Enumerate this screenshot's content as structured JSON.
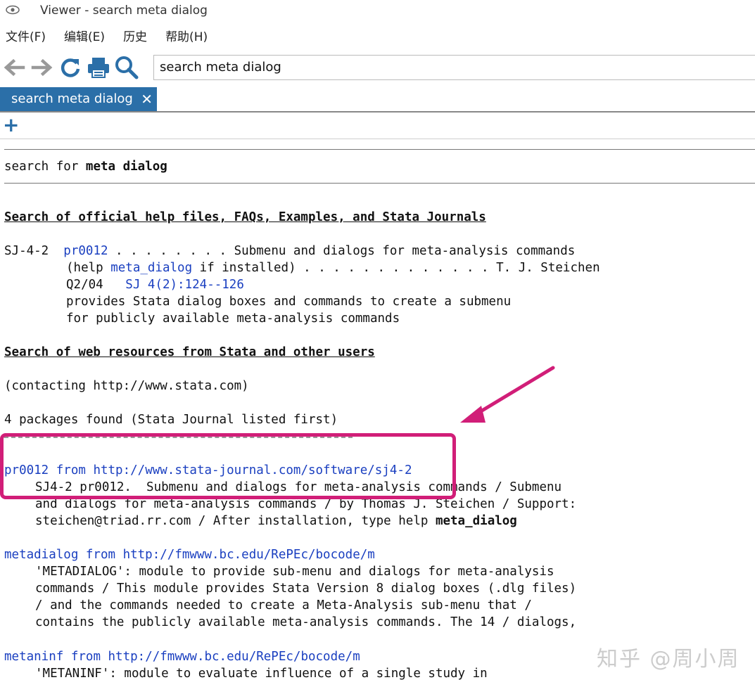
{
  "window": {
    "title": "Viewer - search meta dialog",
    "icon": "eye-icon"
  },
  "menu": [
    {
      "label": "文件(F)"
    },
    {
      "label": "编辑(E)"
    },
    {
      "label": "历史"
    },
    {
      "label": "帮助(H)"
    }
  ],
  "toolbar": {
    "icons": [
      "back-arrow-icon",
      "forward-arrow-icon",
      "refresh-icon",
      "print-icon",
      "search-icon"
    ],
    "address": "search meta dialog"
  },
  "tab": {
    "label": "search meta dialog",
    "close": "✕"
  },
  "new_tab": "+",
  "content": {
    "search_prefix": "search for ",
    "search_term": "meta dialog",
    "section_official": "Search of official help files, FAQs, Examples, and Stata Journals",
    "official": {
      "id": "SJ-4-2",
      "pkg": "pr0012",
      "dots1": " . . . . . . . . ",
      "desc1": "Submenu and dialogs for meta-analysis commands",
      "help_pre": "(help ",
      "help_link": "meta_dialog",
      "help_post": " if installed) . . . . . . . . . . . . . T. J. Steichen",
      "date": "Q2/04",
      "journal_link": "SJ 4(2):124--126",
      "line4": "provides Stata dialog boxes and commands to create a submenu",
      "line5": "for publicly available meta-analysis commands"
    },
    "section_web": "Search of web resources from Stata and other users",
    "contacting": "(contacting http://www.stata.com)",
    "found": "4 packages found (Stata Journal listed first)",
    "packages": [
      {
        "name": "pr0012",
        "from": " from ",
        "url": "http://www.stata-journal.com/software/sj4-2",
        "lines": [
          "SJ4-2 pr0012.  Submenu and dialogs for meta-analysis commands / Submenu",
          "and dialogs for meta-analysis commands / by Thomas J. Steichen / Support:"
        ],
        "last_pre": "steichen@triad.rr.com / After installation, type help ",
        "last_bold": "meta_dialog"
      },
      {
        "name": "metadialog",
        "from": " from ",
        "url": "http://fmwww.bc.edu/RePEc/bocode/m",
        "lines": [
          "'METADIALOG': module to provide sub-menu and dialogs for meta-analysis",
          "commands / This module provides Stata Version 8 dialog boxes (.dlg files)",
          "/ and the commands needed to create a Meta-Analysis sub-menu that /",
          "contains the publicly available meta-analysis commands. The 14 / dialogs,"
        ]
      },
      {
        "name": "metaninf",
        "from": " from ",
        "url": "http://fmwww.bc.edu/RePEc/bocode/m",
        "lines": [
          "'METANINF': module to evaluate influence of a single study in"
        ]
      }
    ]
  },
  "watermark": "知乎 @周小周",
  "colors": {
    "tab": "#2b6fa8",
    "link": "#1a3fc0",
    "highlight": "#d11e78"
  }
}
